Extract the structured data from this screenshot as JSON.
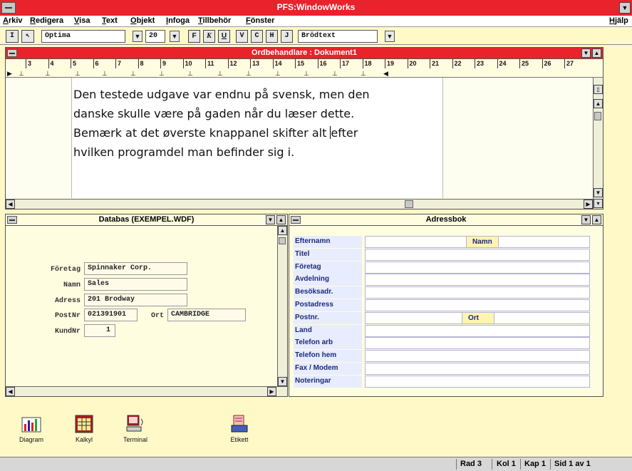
{
  "app": {
    "title": "PFS:WindowWorks"
  },
  "menu": {
    "items": [
      "Arkiv",
      "Redigera",
      "Visa",
      "Text",
      "Objekt",
      "Infoga",
      "Tillbehör",
      "Fönster"
    ],
    "help": "Hjälp"
  },
  "toolbar": {
    "font": "Optima",
    "size": "20",
    "bold": "F",
    "italic": "K",
    "underline": "U",
    "align_left": "V",
    "align_center": "C",
    "align_right": "H",
    "align_justify": "J",
    "style": "Brödtext"
  },
  "word_processor": {
    "title": "Ordbehandlare : Dokument1",
    "ruler": [
      "3",
      "4",
      "5",
      "6",
      "7",
      "8",
      "9",
      "10",
      "11",
      "12",
      "13",
      "14",
      "15",
      "16",
      "17",
      "18",
      "19",
      "20",
      "21",
      "22",
      "23",
      "24",
      "25",
      "26",
      "27"
    ],
    "lines": [
      "Den testede udgave var endnu på svensk, men den",
      "danske skulle være på gaden når du læser dette.",
      "Bemærk at det øverste knappanel skifter alt ",
      "efter",
      "hvilken programdel man befinder sig i."
    ]
  },
  "database": {
    "title": "Databas (EXEMPEL.WDF)",
    "fields": {
      "company_label": "Företag",
      "company_value": "Spinnaker Corp.",
      "name_label": "Namn",
      "name_value": "Sales",
      "address_label": "Adress",
      "address_value": "201 Brodway",
      "zip_label": "PostNr",
      "zip_value": "021391901",
      "city_label": "Ort",
      "city_value": "CAMBRIDGE",
      "customer_label": "KundNr",
      "customer_value": "1"
    }
  },
  "address_book": {
    "title": "Adressbok",
    "labels": [
      "Efternamn",
      "Titel",
      "Företag",
      "Avdelning",
      "Besöksadr.",
      "Postadress",
      "Postnr.",
      "Land",
      "Telefon arb",
      "Telefon hem",
      "Fax / Modem",
      "Noteringar"
    ],
    "name_label": "Namn",
    "city_label": "Ort"
  },
  "desktop_icons": [
    "Diagram",
    "Kalkyl",
    "Terminal",
    "Etikett"
  ],
  "statusbar": {
    "row": "Rad 3",
    "col": "Kol 1",
    "chapter": "Kap 1",
    "page": "Sid 1 av 1"
  }
}
